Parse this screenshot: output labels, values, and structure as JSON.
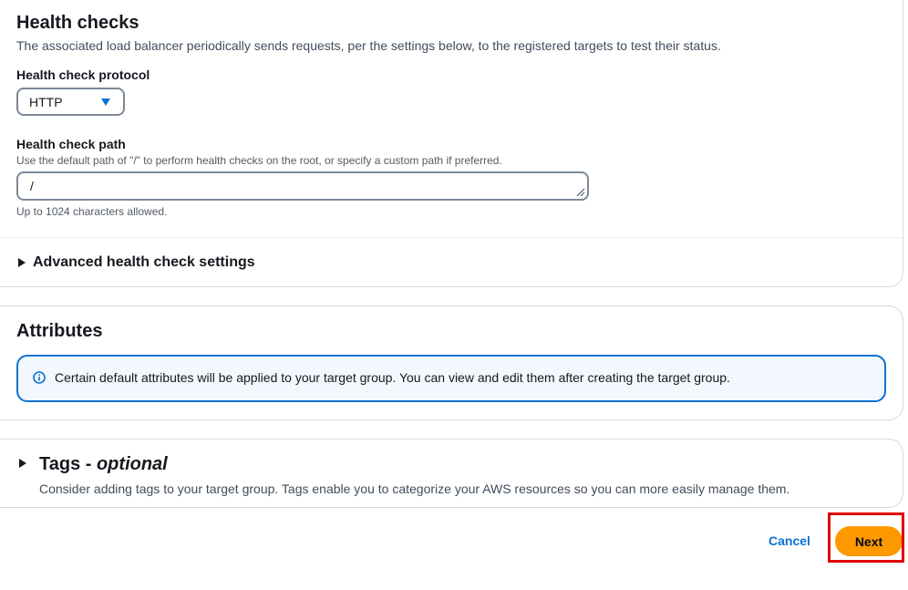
{
  "health_checks": {
    "title": "Health checks",
    "description": "The associated load balancer periodically sends requests, per the settings below, to the registered targets to test their status.",
    "protocol": {
      "label": "Health check protocol",
      "value": "HTTP",
      "icon": "caret-down-icon"
    },
    "path": {
      "label": "Health check path",
      "description": "Use the default path of \"/\" to perform health checks on the root, or specify a custom path if preferred.",
      "value": "/",
      "constraint": "Up to 1024 characters allowed."
    },
    "advanced": {
      "label": "Advanced health check settings",
      "expanded": false
    }
  },
  "attributes": {
    "title": "Attributes",
    "info_text": "Certain default attributes will be applied to your target group. You can view and edit them after creating the target group.",
    "info_icon": "info-icon",
    "info_color": "#0972d3"
  },
  "tags": {
    "title": "Tags - ",
    "title_optional": "optional",
    "description": "Consider adding tags to your target group. Tags enable you to categorize your AWS resources so you can more easily manage them.",
    "expanded": false
  },
  "footer": {
    "cancel_label": "Cancel",
    "next_label": "Next",
    "primary_color": "#ff9900",
    "link_color": "#0972d3",
    "highlight_color": "#e00000"
  }
}
